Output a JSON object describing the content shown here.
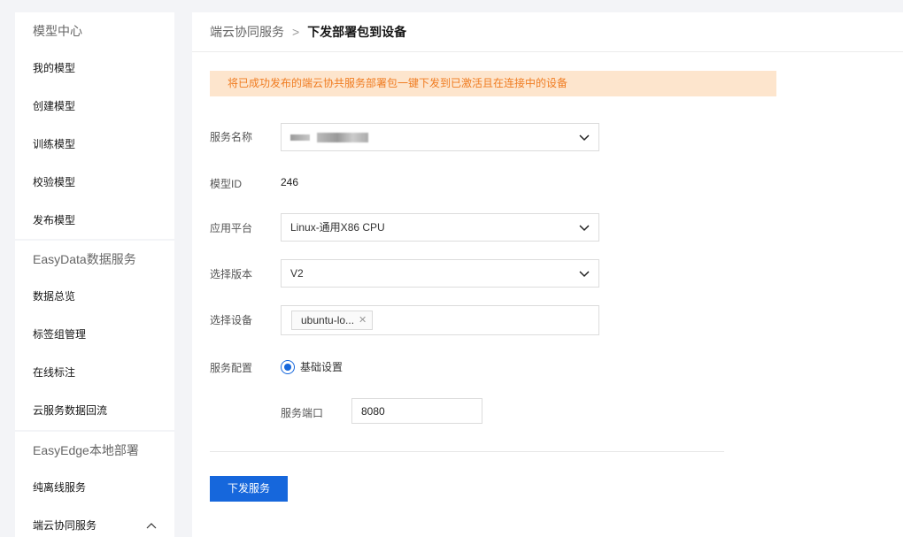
{
  "sidebar": {
    "sections": [
      {
        "title": "模型中心",
        "items": [
          "我的模型",
          "创建模型",
          "训练模型",
          "校验模型",
          "发布模型"
        ]
      },
      {
        "title": "EasyData数据服务",
        "items": [
          "数据总览",
          "标签组管理",
          "在线标注",
          "云服务数据回流"
        ]
      },
      {
        "title": "EasyEdge本地部署",
        "items": [
          "纯离线服务",
          "端云协同服务"
        ]
      }
    ]
  },
  "breadcrumb": {
    "parent": "端云协同服务",
    "separator": ">",
    "current": "下发部署包到设备"
  },
  "notice": "将已成功发布的端云协共服务部署包一键下发到已激活且在连接中的设备",
  "form": {
    "service_name_label": "服务名称",
    "model_id_label": "模型ID",
    "model_id_value": "246",
    "platform_label": "应用平台",
    "platform_value": "Linux-通用X86 CPU",
    "version_label": "选择版本",
    "version_value": "V2",
    "device_label": "选择设备",
    "device_tag": "ubuntu-lo...",
    "config_label": "服务配置",
    "config_option": "基础设置",
    "port_label": "服务端口",
    "port_value": "8080",
    "submit_label": "下发服务"
  },
  "colors": {
    "primary": "#1667dc",
    "notice_bg": "#fde5cd",
    "notice_text": "#f07c21"
  }
}
